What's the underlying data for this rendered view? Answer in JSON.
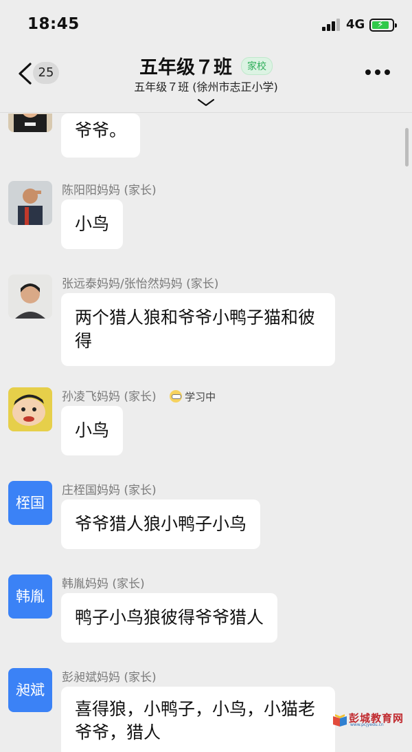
{
  "status_bar": {
    "time": "18:45",
    "network": "4G",
    "battery_fill": 0.85
  },
  "header": {
    "back_count": "25",
    "title": "五年级７班",
    "tag": "家校",
    "subtitle": "五年级７班 (徐州市志正小学)"
  },
  "messages": [
    {
      "sender": "",
      "text": "爷爷。",
      "avatar_icon": "boy-with-hat-photo"
    },
    {
      "sender": "陈阳阳妈妈 (家长)",
      "text": "小鸟",
      "avatar_icon": "boy-saluting-photo"
    },
    {
      "sender": "张远泰妈妈/张怡然妈妈 (家长)",
      "text": "两个猎人狼和爷爷小鸭子猫和彼得",
      "avatar_icon": "boy-portrait-photo"
    },
    {
      "sender": "孙凌飞妈妈 (家长)",
      "status": "学习中",
      "text": "小鸟",
      "avatar_icon": "cartoon-boy"
    },
    {
      "sender": "庄桎国妈妈 (家长)",
      "avatar_text": "桎国",
      "text": "爷爷猎人狼小鸭子小鸟"
    },
    {
      "sender": "韩胤妈妈 (家长)",
      "avatar_text": "韩胤",
      "text": "鸭子小鸟狼彼得爷爷猎人"
    },
    {
      "sender": "彭昶斌妈妈 (家长)",
      "avatar_text": "昶斌",
      "text": "喜得狼，小鸭子，小鸟，小猫老爷爷，猎人"
    }
  ],
  "watermark": {
    "text": "彭城教育网",
    "url": "www.pcjyedu.cn"
  },
  "colors": {
    "accent_green": "#2fae5a",
    "avatar_blue": "#3b82f6",
    "background": "#ededed"
  }
}
